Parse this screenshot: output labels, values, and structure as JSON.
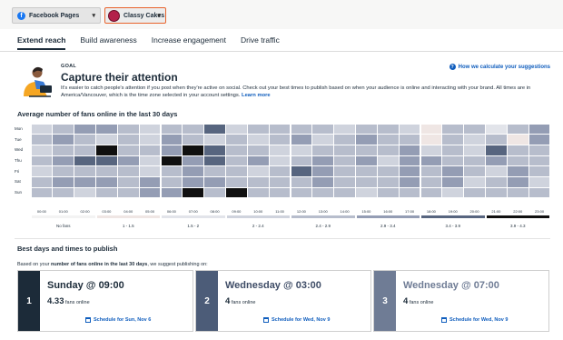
{
  "topbar": {
    "network_dropdown": "Facebook Pages",
    "account_dropdown": "Classy Cakes"
  },
  "tabs": [
    "Extend reach",
    "Build awareness",
    "Increase engagement",
    "Drive traffic"
  ],
  "goal": {
    "eyebrow": "GOAL",
    "headline": "Capture their attention",
    "description": "It's easier to catch people's attention if you post when they're active on social. Check out your best times to publish based on when your audience is online and interacting with your brand. All times are in America/Vancouver, which is the time zone selected in your account settings.",
    "learn_more": "Learn more",
    "help_link": "How we calculate your suggestions"
  },
  "heatmap_section": {
    "title": "Average number of fans online in the last 30 days",
    "days": [
      "Mon",
      "Tue",
      "Wed",
      "Thu",
      "Fri",
      "Sat",
      "Sun"
    ],
    "hours": [
      "00:00",
      "01:00",
      "02:00",
      "03:00",
      "04:00",
      "05:00",
      "06:00",
      "07:00",
      "08:00",
      "09:00",
      "10:00",
      "11:00",
      "12:00",
      "13:00",
      "14:00",
      "15:00",
      "16:00",
      "17:00",
      "18:00",
      "19:00",
      "20:00",
      "21:00",
      "22:00",
      "23:00"
    ],
    "legend": [
      {
        "label": "No fans",
        "color": "#ffffff"
      },
      {
        "label": "1 - 1.5",
        "color": "#efe6e4"
      },
      {
        "label": "1.5 - 2",
        "color": "#e2e4ea"
      },
      {
        "label": "2 - 2.4",
        "color": "#cfd3dd"
      },
      {
        "label": "2.4 - 2.9",
        "color": "#b7bdcc"
      },
      {
        "label": "2.9 - 3.4",
        "color": "#949db4"
      },
      {
        "label": "3.4 - 3.9",
        "color": "#57657f"
      },
      {
        "label": "3.9 - 4.3",
        "color": "#101010"
      }
    ]
  },
  "best_times": {
    "title": "Best days and times to publish",
    "intro_prefix": "Based on your ",
    "intro_bold": "number of fans online in the last 30 days",
    "intro_suffix": ", we suggest publishing on:",
    "cards": [
      {
        "rank": "1",
        "title": "Sunday @ 09:00",
        "value": "4.33",
        "unit": "fans online",
        "schedule": "Schedule for Sun, Nov 6",
        "accent": "#1c2b39"
      },
      {
        "rank": "2",
        "title": "Wednesday @ 03:00",
        "value": "4",
        "unit": "fans online",
        "schedule": "Schedule for Wed, Nov 9",
        "accent": "#4c5c78"
      },
      {
        "rank": "3",
        "title": "Wednesday @ 07:00",
        "value": "4",
        "unit": "fans online",
        "schedule": "Schedule for Wed, Nov 9",
        "accent": "#6f7c95"
      }
    ]
  },
  "chart_data": {
    "type": "heatmap",
    "title": "Average number of fans online in the last 30 days",
    "x": [
      "00:00",
      "01:00",
      "02:00",
      "03:00",
      "04:00",
      "05:00",
      "06:00",
      "07:00",
      "08:00",
      "09:00",
      "10:00",
      "11:00",
      "12:00",
      "13:00",
      "14:00",
      "15:00",
      "16:00",
      "17:00",
      "18:00",
      "19:00",
      "20:00",
      "21:00",
      "22:00",
      "23:00"
    ],
    "y": [
      "Mon",
      "Tue",
      "Wed",
      "Thu",
      "Fri",
      "Sat",
      "Sun"
    ],
    "values": [
      [
        2.2,
        2.4,
        3.3,
        3.3,
        2.4,
        2.1,
        2.6,
        2.6,
        3.4,
        2.2,
        2.4,
        2.4,
        2.7,
        2.7,
        2.2,
        2.4,
        2.4,
        2.2,
        1.2,
        2.4,
        2.4,
        1.7,
        2.6,
        3.1
      ],
      [
        2.4,
        3.3,
        2.7,
        2.2,
        2.6,
        2.2,
        3.3,
        2.6,
        2.1,
        2.4,
        2.2,
        2.6,
        3.3,
        2.2,
        2.6,
        2.9,
        2.6,
        2.6,
        1.4,
        2.6,
        2.2,
        2.6,
        1.2,
        3.3
      ],
      [
        2.1,
        2.6,
        2.6,
        4.0,
        2.6,
        2.4,
        2.9,
        4.0,
        3.4,
        2.6,
        2.4,
        2.2,
        2.2,
        2.6,
        2.7,
        2.4,
        2.6,
        3.1,
        2.2,
        2.7,
        2.2,
        3.4,
        2.4,
        2.4
      ],
      [
        2.4,
        2.9,
        3.4,
        3.4,
        3.1,
        2.2,
        4.0,
        2.9,
        3.4,
        2.7,
        2.9,
        2.2,
        2.4,
        3.3,
        2.4,
        3.1,
        2.2,
        2.9,
        3.1,
        2.4,
        2.4,
        3.3,
        2.6,
        2.6
      ],
      [
        2.2,
        2.4,
        2.7,
        2.4,
        2.6,
        2.2,
        2.4,
        3.3,
        2.7,
        2.4,
        2.2,
        2.4,
        3.4,
        3.1,
        2.6,
        2.6,
        2.4,
        2.9,
        2.4,
        3.1,
        2.4,
        2.2,
        3.1,
        2.4
      ],
      [
        2.6,
        2.9,
        3.1,
        3.1,
        2.4,
        3.1,
        2.7,
        2.9,
        3.1,
        2.6,
        2.7,
        2.6,
        2.4,
        3.1,
        2.6,
        2.4,
        2.6,
        3.1,
        2.4,
        3.1,
        2.2,
        2.7,
        3.3,
        2.2
      ],
      [
        2.4,
        2.6,
        2.2,
        2.6,
        2.4,
        2.9,
        2.9,
        4.0,
        2.6,
        4.3,
        2.4,
        2.6,
        2.4,
        2.6,
        2.7,
        2.2,
        2.6,
        2.4,
        2.6,
        2.2,
        2.4,
        2.6,
        2.4,
        2.7
      ]
    ],
    "legend_bins": [
      "No fans",
      "1 - 1.5",
      "1.5 - 2",
      "2 - 2.4",
      "2.4 - 2.9",
      "2.9 - 3.4",
      "3.4 - 3.9",
      "3.9 - 4.3"
    ]
  }
}
